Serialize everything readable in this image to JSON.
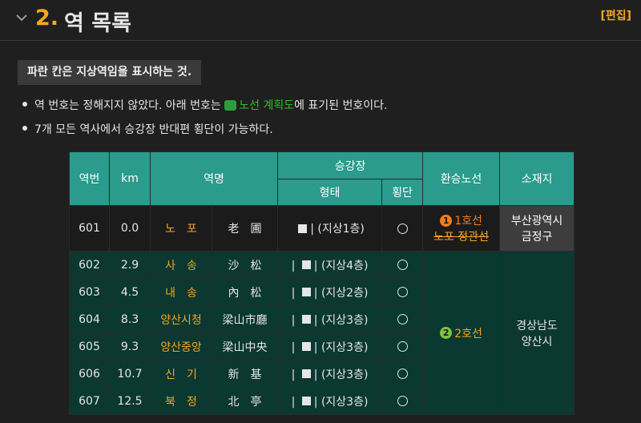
{
  "header": {
    "section_number": "2.",
    "title": "역 목록",
    "edit_label": "[편집]"
  },
  "notice": "파란 칸은 지상역임을 표시하는 것.",
  "bullets": {
    "b1_before": "역 번호는 정해지지 않았다. 아래 번호는",
    "b1_link": "노선 계획도",
    "b1_after": "에 표기된 번호이다.",
    "b2": "7개 모든 역사에서 승강장 반대편 횡단이 가능하다."
  },
  "table": {
    "headers": {
      "number": "역번",
      "km": "km",
      "name": "역명",
      "platform": "승강장",
      "form": "형태",
      "cross": "횡단",
      "transfer": "환승노선",
      "location": "소재지"
    },
    "rows": [
      {
        "no": "601",
        "km": "0.0",
        "ko": "노　포",
        "hanja": "老　圃",
        "form": "| (지상1층)",
        "cross": "○",
        "transfer": [
          {
            "num": "1",
            "text": "1호선"
          },
          {
            "text": "노포 정관선",
            "strike": true
          }
        ],
        "location": "부산광역시\n금정구"
      },
      {
        "no": "602",
        "km": "2.9",
        "ko": "사　송",
        "hanja": "沙　松",
        "form": "| (지상4층)",
        "cross": "○"
      },
      {
        "no": "603",
        "km": "4.5",
        "ko": "내　송",
        "hanja": "內　松",
        "form": "| (지상2층)",
        "cross": "○"
      },
      {
        "no": "604",
        "km": "8.3",
        "ko": "양산시청",
        "hanja": "梁山市廳",
        "form": "| (지상3층)",
        "cross": "○"
      },
      {
        "no": "605",
        "km": "9.3",
        "ko": "양산중앙",
        "hanja": "梁山中央",
        "form": "| (지상3층)",
        "cross": "○",
        "transfer": [
          {
            "num": "2",
            "text": "2호선"
          }
        ]
      },
      {
        "no": "606",
        "km": "10.7",
        "ko": "신　기",
        "hanja": "新　基",
        "form": "| (지상3층)",
        "cross": "○"
      },
      {
        "no": "607",
        "km": "12.5",
        "ko": "북　정",
        "hanja": "北　亭",
        "form": "| (지상3층)",
        "cross": "○"
      }
    ],
    "region2": "경상남도\n양산시"
  },
  "colors": {
    "accent": "#f5a623",
    "header_teal": "#2a9b8c",
    "ground_row": "#0b3830",
    "line1": "#f57c1f",
    "line2": "#7ec245"
  }
}
